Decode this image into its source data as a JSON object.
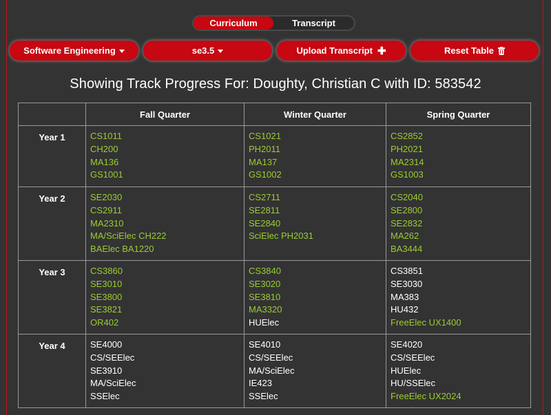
{
  "toggle": {
    "active": "Curriculum",
    "inactive": "Transcript"
  },
  "buttons": {
    "track": "Software Engineering",
    "version": "se3.5",
    "upload": "Upload Transcript",
    "reset": "Reset Table"
  },
  "title": "Showing Track Progress For: Doughty, Christian C with ID: 583542",
  "colors": {
    "accent": "#c70711",
    "completed": "#9acd32",
    "pending": "#ffffff",
    "background": "#333333"
  },
  "table": {
    "headers": [
      "",
      "Fall Quarter",
      "Winter Quarter",
      "Spring Quarter"
    ],
    "rows": [
      {
        "year": "Year 1",
        "cells": [
          [
            {
              "code": "CS1011",
              "done": true
            },
            {
              "code": "CH200",
              "done": true
            },
            {
              "code": "MA136",
              "done": true
            },
            {
              "code": "GS1001",
              "done": true
            }
          ],
          [
            {
              "code": "CS1021",
              "done": true
            },
            {
              "code": "PH2011",
              "done": true
            },
            {
              "code": "MA137",
              "done": true
            },
            {
              "code": "GS1002",
              "done": true
            }
          ],
          [
            {
              "code": "CS2852",
              "done": true
            },
            {
              "code": "PH2021",
              "done": true
            },
            {
              "code": "MA2314",
              "done": true
            },
            {
              "code": "GS1003",
              "done": true
            }
          ]
        ]
      },
      {
        "year": "Year 2",
        "cells": [
          [
            {
              "code": "SE2030",
              "done": true
            },
            {
              "code": "CS2911",
              "done": true
            },
            {
              "code": "MA2310",
              "done": true
            },
            {
              "code": "MA/SciElec CH222",
              "done": true
            },
            {
              "code": "BAElec BA1220",
              "done": true
            }
          ],
          [
            {
              "code": "CS2711",
              "done": true
            },
            {
              "code": "SE2811",
              "done": true
            },
            {
              "code": "SE2840",
              "done": true
            },
            {
              "code": "SciElec PH2031",
              "done": true
            }
          ],
          [
            {
              "code": "CS2040",
              "done": true
            },
            {
              "code": "SE2800",
              "done": true
            },
            {
              "code": "SE2832",
              "done": true
            },
            {
              "code": "MA262",
              "done": true
            },
            {
              "code": "BA3444",
              "done": true
            }
          ]
        ]
      },
      {
        "year": "Year 3",
        "cells": [
          [
            {
              "code": "CS3860",
              "done": true
            },
            {
              "code": "SE3010",
              "done": true
            },
            {
              "code": "SE3800",
              "done": true
            },
            {
              "code": "SE3821",
              "done": true
            },
            {
              "code": "OR402",
              "done": true
            }
          ],
          [
            {
              "code": "CS3840",
              "done": true
            },
            {
              "code": "SE3020",
              "done": true
            },
            {
              "code": "SE3810",
              "done": true
            },
            {
              "code": "MA3320",
              "done": true
            },
            {
              "code": "HUElec",
              "done": false
            }
          ],
          [
            {
              "code": "CS3851",
              "done": false
            },
            {
              "code": "SE3030",
              "done": false
            },
            {
              "code": "MA383",
              "done": false
            },
            {
              "code": "HU432",
              "done": false
            },
            {
              "code": "FreeElec UX1400",
              "done": true
            }
          ]
        ]
      },
      {
        "year": "Year 4",
        "cells": [
          [
            {
              "code": "SE4000",
              "done": false
            },
            {
              "code": "CS/SEElec",
              "done": false
            },
            {
              "code": "SE3910",
              "done": false
            },
            {
              "code": "MA/SciElec",
              "done": false
            },
            {
              "code": "SSElec",
              "done": false
            }
          ],
          [
            {
              "code": "SE4010",
              "done": false
            },
            {
              "code": "CS/SEElec",
              "done": false
            },
            {
              "code": "MA/SciElec",
              "done": false
            },
            {
              "code": "IE423",
              "done": false
            },
            {
              "code": "SSElec",
              "done": false
            }
          ],
          [
            {
              "code": "SE4020",
              "done": false
            },
            {
              "code": "CS/SEElec",
              "done": false
            },
            {
              "code": "HUElec",
              "done": false
            },
            {
              "code": "HU/SSElec",
              "done": false
            },
            {
              "code": "FreeElec UX2024",
              "done": true
            }
          ]
        ]
      }
    ]
  }
}
